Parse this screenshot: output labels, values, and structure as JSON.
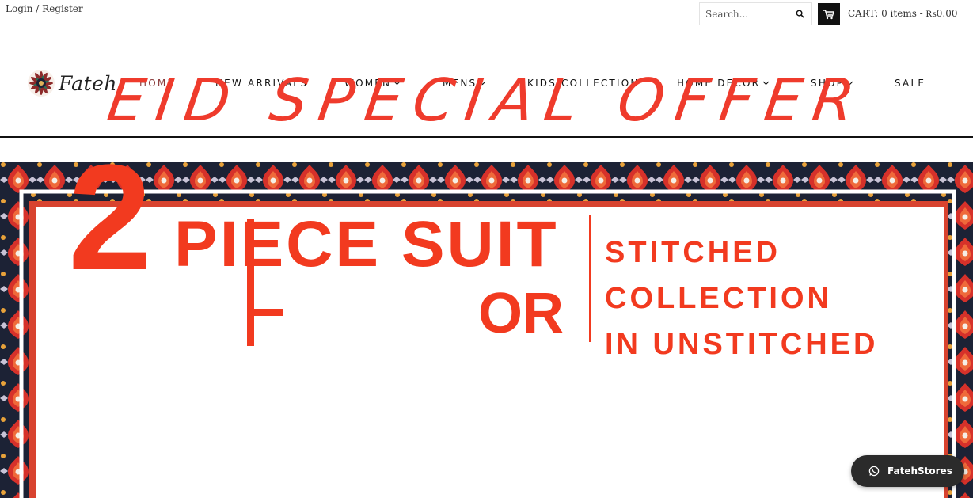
{
  "topbar": {
    "login": "Login",
    "separator": "/",
    "register": "Register",
    "search_placeholder": "Search...",
    "cart_text": "CART: 0 items - ₨0.00"
  },
  "logo": {
    "text": "Fateh"
  },
  "nav": [
    {
      "label": "HOME",
      "active": true,
      "dropdown": false
    },
    {
      "label": "NEW ARRIVALS",
      "active": false,
      "dropdown": false
    },
    {
      "label": "WOMEN",
      "active": false,
      "dropdown": true
    },
    {
      "label": "MENS",
      "active": false,
      "dropdown": true
    },
    {
      "label": "KIDS COLLECTION",
      "active": false,
      "dropdown": false
    },
    {
      "label": "HOME DECOR",
      "active": false,
      "dropdown": true
    },
    {
      "label": "SHOP",
      "active": false,
      "dropdown": true
    },
    {
      "label": "SALE",
      "active": false,
      "dropdown": false
    }
  ],
  "hero": {
    "title": "EID SPECIAL OFFER",
    "big_number": "2",
    "piece_text": "PIECE SUIT",
    "or_text": "OR",
    "right_lines": [
      "STITCHED",
      "COLLECTION",
      "IN UNSTITCHED"
    ],
    "accent": "#f23a1f"
  },
  "whatsapp": {
    "label": "FatehStores"
  },
  "colors": {
    "active_nav": "#8a3a3a",
    "pattern_dark": "#1c2235",
    "pattern_red": "#d6312a"
  }
}
